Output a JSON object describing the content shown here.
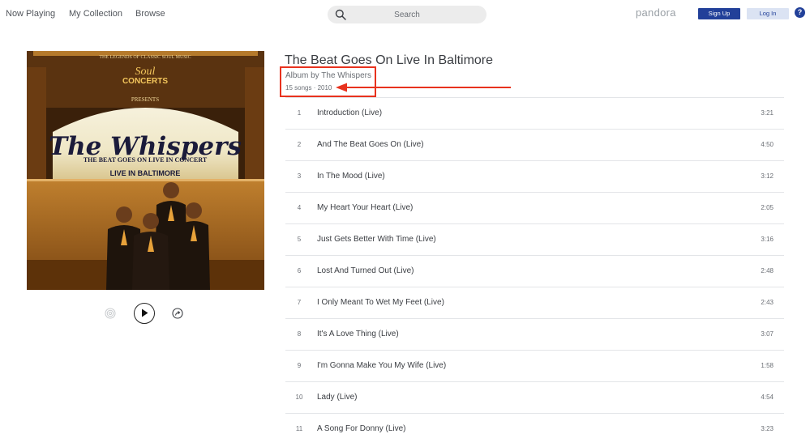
{
  "nav": {
    "now_playing": "Now Playing",
    "my_collection": "My Collection",
    "browse": "Browse"
  },
  "search": {
    "placeholder": "Search"
  },
  "brand": {
    "logo": "pandora",
    "color": "#224099"
  },
  "auth": {
    "sign_up": "Sign Up",
    "log_in": "Log In",
    "help": "?"
  },
  "album": {
    "title": "The Beat Goes On Live In Baltimore",
    "byline": "Album by The Whispers",
    "meta": "15 songs · 2010",
    "art": {
      "top_banner": "THE LEGENDS OF CLASSIC SOUL MUSIC",
      "logo_line1": "Soul",
      "logo_line2": "CONCERTS",
      "presents": "PRESENTS",
      "band": "The Whispers",
      "tagline": "THE BEAT GOES ON LIVE IN CONCERT",
      "venue": "LIVE IN BALTIMORE"
    }
  },
  "annotation": {
    "color": "#e8321e"
  },
  "tracks": [
    {
      "num": "1",
      "title": "Introduction (Live)",
      "duration": "3:21"
    },
    {
      "num": "2",
      "title": "And The Beat Goes On (Live)",
      "duration": "4:50"
    },
    {
      "num": "3",
      "title": "In The Mood (Live)",
      "duration": "3:12"
    },
    {
      "num": "4",
      "title": "My Heart Your Heart (Live)",
      "duration": "2:05"
    },
    {
      "num": "5",
      "title": "Just Gets Better With Time (Live)",
      "duration": "3:16"
    },
    {
      "num": "6",
      "title": "Lost And Turned Out (Live)",
      "duration": "2:48"
    },
    {
      "num": "7",
      "title": "I Only Meant To Wet My Feet (Live)",
      "duration": "2:43"
    },
    {
      "num": "8",
      "title": "It's A Love Thing (Live)",
      "duration": "3:07"
    },
    {
      "num": "9",
      "title": "I'm Gonna Make You My Wife (Live)",
      "duration": "1:58"
    },
    {
      "num": "10",
      "title": "Lady (Live)",
      "duration": "4:54"
    },
    {
      "num": "11",
      "title": "A Song For Donny (Live)",
      "duration": "3:23"
    }
  ]
}
